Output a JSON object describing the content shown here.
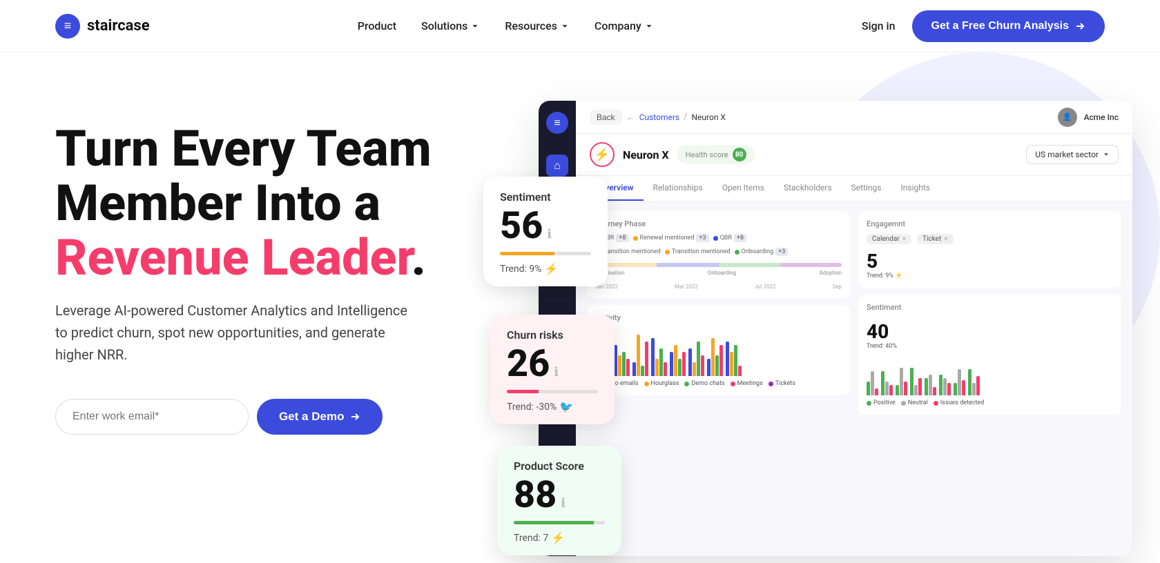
{
  "nav": {
    "logo": {
      "icon": "≡",
      "text": "staircase"
    },
    "links": [
      {
        "label": "Product",
        "hasDropdown": false
      },
      {
        "label": "Solutions",
        "hasDropdown": true
      },
      {
        "label": "Resources",
        "hasDropdown": true
      },
      {
        "label": "Company",
        "hasDropdown": true
      }
    ],
    "signin_label": "Sign in",
    "cta_label": "Get a Free Churn Analysis"
  },
  "hero": {
    "title_line1": "Turn Every Team",
    "title_line2": "Member Into a",
    "title_line3_normal": "",
    "title_line3_red": "Revenue Leader",
    "title_period": ".",
    "subtitle": "Leverage AI-powered Customer Analytics and Intelligence to predict churn, spot new opportunities, and generate higher NRR.",
    "email_placeholder": "Enter work email*",
    "demo_label": "Get a Demo"
  },
  "dashboard": {
    "back_label": "Back",
    "breadcrumb_link": "Customers",
    "breadcrumb_current": "Neuron X",
    "company_name": "Acme Inc",
    "customer_name": "Neuron X",
    "health_label": "Health score",
    "health_score": "80",
    "sector_label": "US market sector",
    "tabs": [
      "Overview",
      "Relationships",
      "Open Items",
      "Stackholders",
      "Settings",
      "Insights"
    ],
    "active_tab": "Overview",
    "journey_label": "Journey Phase",
    "activity_label": "Activity",
    "engagement_label": "Engagemnt",
    "sentiment_label": "Sentiment",
    "sentiment_score": "40",
    "sentiment_trend": "Trend: 40%",
    "tags": {
      "calendar": "Calendar",
      "ticket": "Ticket"
    },
    "journey_phases": [
      "Acquisation",
      "Onboarding",
      "Adoption"
    ],
    "journey_dates": [
      "Jan 2022",
      "Mar 2022",
      "Jul 2022",
      "Sep"
    ],
    "dots": {
      "qbr": "QBR +8",
      "renewal": "Renewal mentioned +3",
      "transition": "Transition mentioned",
      "onboarding": "Onboarding +3"
    }
  },
  "cards": {
    "sentiment": {
      "label": "Sentiment",
      "score": "56",
      "bar_color": "#F5A623",
      "trend_text": "Trend: 9%",
      "trend_icon": "↑",
      "trend_color": "#4CAF50"
    },
    "churn": {
      "label": "Churn risks",
      "score": "26",
      "bar_color": "#F53D6B",
      "trend_text": "Trend: -30%",
      "trend_icon": "↓",
      "trend_color": "#F53D6B"
    },
    "product": {
      "label": "Product Score",
      "score": "88",
      "bar_color": "#4CAF50",
      "trend_text": "Trend: 7",
      "trend_icon": "↑",
      "trend_color": "#4CAF50"
    }
  },
  "activity_bars": [
    {
      "heights": [
        30,
        50,
        20,
        40
      ],
      "colors": [
        "#3B4BDB",
        "#F5A623",
        "#4CAF50",
        "#F53D6B"
      ]
    },
    {
      "heights": [
        45,
        30,
        35,
        25
      ],
      "colors": [
        "#3B4BDB",
        "#F5A623",
        "#4CAF50",
        "#F53D6B"
      ]
    },
    {
      "heights": [
        20,
        60,
        15,
        50
      ],
      "colors": [
        "#3B4BDB",
        "#F5A623",
        "#4CAF50",
        "#F53D6B"
      ]
    },
    {
      "heights": [
        55,
        25,
        40,
        20
      ],
      "colors": [
        "#3B4BDB",
        "#F5A623",
        "#4CAF50",
        "#F53D6B"
      ]
    },
    {
      "heights": [
        35,
        45,
        25,
        35
      ],
      "colors": [
        "#3B4BDB",
        "#F5A623",
        "#4CAF50",
        "#F53D6B"
      ]
    },
    {
      "heights": [
        40,
        20,
        50,
        30
      ],
      "colors": [
        "#3B4BDB",
        "#F5A623",
        "#4CAF50",
        "#F53D6B"
      ]
    },
    {
      "heights": [
        25,
        55,
        30,
        45
      ],
      "colors": [
        "#3B4BDB",
        "#F5A623",
        "#4CAF50",
        "#F53D6B"
      ]
    },
    {
      "heights": [
        50,
        35,
        45,
        15
      ],
      "colors": [
        "#3B4BDB",
        "#F5A623",
        "#4CAF50",
        "#F53D6B"
      ]
    }
  ],
  "sentiment_bars": [
    {
      "heights": [
        20,
        35,
        10
      ],
      "colors": [
        "#4CAF50",
        "#aaa",
        "#F53D6B"
      ]
    },
    {
      "heights": [
        35,
        20,
        15
      ],
      "colors": [
        "#4CAF50",
        "#aaa",
        "#F53D6B"
      ]
    },
    {
      "heights": [
        15,
        40,
        20
      ],
      "colors": [
        "#4CAF50",
        "#aaa",
        "#F53D6B"
      ]
    },
    {
      "heights": [
        40,
        15,
        25
      ],
      "colors": [
        "#4CAF50",
        "#aaa",
        "#F53D6B"
      ]
    },
    {
      "heights": [
        25,
        30,
        12
      ],
      "colors": [
        "#4CAF50",
        "#aaa",
        "#F53D6B"
      ]
    },
    {
      "heights": [
        30,
        25,
        18
      ],
      "colors": [
        "#4CAF50",
        "#aaa",
        "#F53D6B"
      ]
    },
    {
      "heights": [
        18,
        38,
        22
      ],
      "colors": [
        "#4CAF50",
        "#aaa",
        "#F53D6B"
      ]
    },
    {
      "heights": [
        38,
        18,
        28
      ],
      "colors": [
        "#4CAF50",
        "#aaa",
        "#F53D6B"
      ]
    }
  ],
  "activity_legend": [
    "Demo emails",
    "Hourglass",
    "Demo chats",
    "Meetings",
    "Tickets"
  ],
  "activity_legend_colors": [
    "#3B4BDB",
    "#F5A623",
    "#4CAF50",
    "#F53D6B",
    "#9C27B0"
  ],
  "sentiment_legend": [
    "Positive",
    "Neutral",
    "Issues detected"
  ],
  "sentiment_legend_colors": [
    "#4CAF50",
    "#aaa",
    "#F53D6B"
  ]
}
